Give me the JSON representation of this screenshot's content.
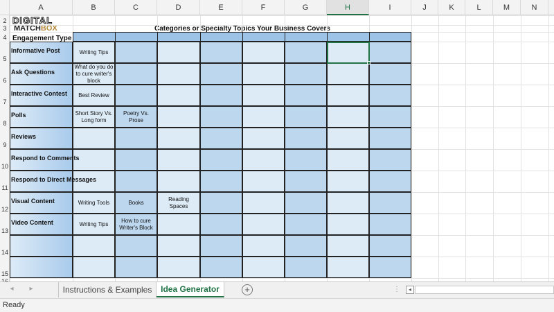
{
  "columns": [
    "A",
    "B",
    "C",
    "D",
    "E",
    "F",
    "G",
    "H",
    "I",
    "J",
    "K",
    "L",
    "M",
    "N"
  ],
  "active_column": "H",
  "rows": [
    "2",
    "3",
    "4",
    "5",
    "6",
    "7",
    "8",
    "9",
    "10",
    "11",
    "12",
    "13",
    "14",
    "15",
    "16"
  ],
  "logo": {
    "line1": "DIGITAL",
    "line2_a": "MATCH",
    "line2_b": "BOX"
  },
  "title": "Categories or Specialty Topics Your Business Covers",
  "engagement_label": "Engagement Type",
  "row_labels": [
    "Informative Post",
    "Ask Questions",
    "Interactive Contest",
    "Polls",
    "Reviews",
    "Respond to Comments",
    "Respond to Direct Messages",
    "Visual Content",
    "Video Content",
    "",
    ""
  ],
  "cells": [
    [
      "Writing Tips",
      "",
      ""
    ],
    [
      "What do you do to cure writer's block",
      "",
      ""
    ],
    [
      "Best Review",
      "",
      ""
    ],
    [
      "Short Story Vs. Long form",
      "Poetry Vs. Prose",
      ""
    ],
    [
      "",
      "",
      ""
    ],
    [
      "",
      "",
      ""
    ],
    [
      "",
      "",
      ""
    ],
    [
      "Writing Tools",
      "Books",
      "Reading Spaces"
    ],
    [
      "Writing Tips",
      "How to cure Writer's Block",
      ""
    ],
    [
      "",
      "",
      ""
    ],
    [
      "",
      "",
      ""
    ]
  ],
  "tabs": [
    {
      "label": "Instructions & Examples",
      "active": false
    },
    {
      "label": "Idea Generator",
      "active": true
    }
  ],
  "add_sheet_symbol": "+",
  "nav_left": "◂",
  "nav_right": "▸",
  "hscroll_dots": "⋮",
  "hscroll_left_arrow": "◂",
  "status": "Ready",
  "colors": {
    "accent": "#217346",
    "header_fill": "#9dc3e6",
    "light_fill": "#ddebf7",
    "mid_fill": "#bdd7ee",
    "label_fill": "#a9cbec"
  }
}
